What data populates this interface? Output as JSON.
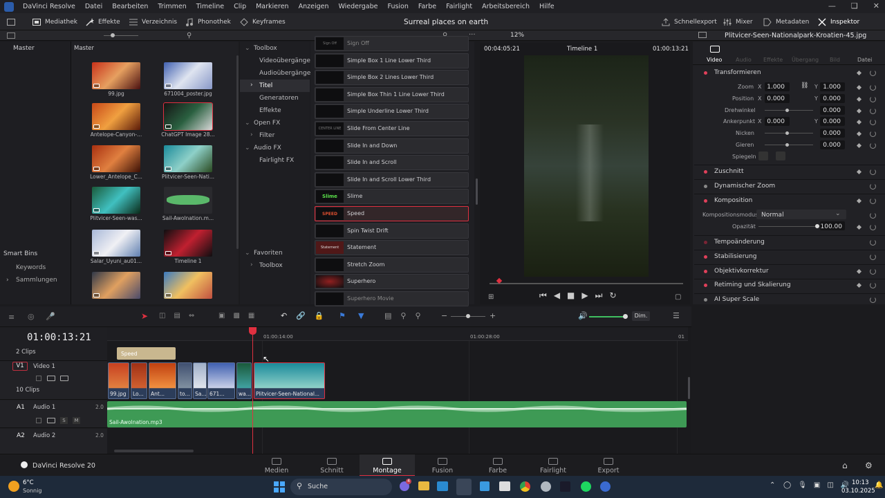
{
  "menu": {
    "app": "DaVinci Resolve",
    "items": [
      "Datei",
      "Bearbeiten",
      "Trimmen",
      "Timeline",
      "Clip",
      "Markieren",
      "Anzeigen",
      "Wiedergabe",
      "Fusion",
      "Farbe",
      "Fairlight",
      "Arbeitsbereich",
      "Hilfe"
    ]
  },
  "toolbar": {
    "mediathek": "Mediathek",
    "effekte": "Effekte",
    "verzeichnis": "Verzeichnis",
    "phonothek": "Phonothek",
    "keyframes": "Keyframes",
    "project_title": "Surreal places on earth",
    "schnellexport": "Schnellexport",
    "mixer": "Mixer",
    "metadaten": "Metadaten",
    "inspektor": "Inspektor"
  },
  "media_pool": {
    "bin_root": "Master",
    "header": "Master",
    "smart_bins": "Smart Bins",
    "smart_items": [
      "Keywords",
      "Sammlungen"
    ],
    "thumbs": [
      {
        "name": "99.jpg",
        "colors": [
          "#c8321a",
          "#e6a060",
          "#4a1010"
        ]
      },
      {
        "name": "671004_poster.jpg",
        "colors": [
          "#4060b0",
          "#dfe4f0",
          "#8898c8"
        ]
      },
      {
        "name": "Antelope-Canyon-...",
        "colors": [
          "#c84818",
          "#f0a040",
          "#5a1a08"
        ]
      },
      {
        "name": "ChatGPT Image 28...",
        "colors": [
          "#141414",
          "#2a6040",
          "#d8d8d8"
        ]
      },
      {
        "name": "Lower_Antelope_C...",
        "colors": [
          "#a83010",
          "#e08040",
          "#3a1005"
        ]
      },
      {
        "name": "Plitvicer-Seen-Nati...",
        "colors": [
          "#1a8a9a",
          "#8ed0c8",
          "#2a4a20"
        ]
      },
      {
        "name": "Plitvicer-Seen-was...",
        "colors": [
          "#1a5a3a",
          "#40c0c0",
          "#0a2a18"
        ]
      },
      {
        "name": "Sail-Awolnation.m...",
        "colors": [
          "#2a2a2e",
          "#5ab86a",
          "#2a2a2e"
        ]
      },
      {
        "name": "Salar_Uyuni_au01...",
        "colors": [
          "#a8b8d8",
          "#f0f0f4",
          "#6080b0"
        ]
      },
      {
        "name": "Timeline 1",
        "colors": [
          "#0e0e10",
          "#c02030",
          "#0e0e10"
        ]
      },
      {
        "name": "",
        "colors": [
          "#303848",
          "#e0a060",
          "#4a4a6a"
        ]
      },
      {
        "name": "",
        "colors": [
          "#3a7ac0",
          "#f0c060",
          "#c05040"
        ]
      }
    ]
  },
  "effects_tree": {
    "toolbox": "Toolbox",
    "video_trans": "Videoübergänge",
    "audio_trans": "Audioübergänge",
    "titel": "Titel",
    "generatoren": "Generatoren",
    "effekte": "Effekte",
    "open_fx": "Open FX",
    "filter": "Filter",
    "audio_fx": "Audio FX",
    "fairlight_fx": "Fairlight FX",
    "favoriten": "Favoriten",
    "toolbox2": "Toolbox"
  },
  "titles": [
    {
      "label": "Sign Off",
      "thumb": "Sign Off"
    },
    {
      "label": "Simple Box 1 Line Lower Third",
      "thumb": ""
    },
    {
      "label": "Simple Box 2 Lines Lower Third",
      "thumb": ""
    },
    {
      "label": "Simple Box Thin 1 Line Lower Third",
      "thumb": ""
    },
    {
      "label": "Simple Underline Lower Third",
      "thumb": ""
    },
    {
      "label": "Slide From Center Line",
      "thumb": "CENTER LINE"
    },
    {
      "label": "Slide In and Down",
      "thumb": ""
    },
    {
      "label": "Slide In and Scroll",
      "thumb": ""
    },
    {
      "label": "Slide In and Scroll Lower Third",
      "thumb": ""
    },
    {
      "label": "Slime",
      "thumb": "Slime"
    },
    {
      "label": "Speed",
      "thumb": "SPEED"
    },
    {
      "label": "Spin Twist Drift",
      "thumb": ""
    },
    {
      "label": "Statement",
      "thumb": "Statement"
    },
    {
      "label": "Stretch Zoom",
      "thumb": ""
    },
    {
      "label": "Superhero",
      "thumb": ""
    },
    {
      "label": "Superhero Movie",
      "thumb": ""
    }
  ],
  "viewer": {
    "zoom": "12%",
    "timecode_left": "00:04:05:21",
    "timeline_name": "Timeline 1",
    "timecode_right": "01:00:13:21"
  },
  "inspector": {
    "filename": "Plitvicer-Seen-Nationalpark-Kroatien-45.jpg",
    "tabs": [
      "Video",
      "Audio",
      "Effekte",
      "Übergang",
      "Bild",
      "Datei"
    ],
    "transform": "Transformieren",
    "zoom": "Zoom",
    "x": "X",
    "y": "Y",
    "zoom_x": "1.000",
    "zoom_y": "1.000",
    "position": "Position",
    "pos_x": "0.000",
    "pos_y": "0.000",
    "drehwinkel": "Drehwinkel",
    "drehwinkel_val": "0.000",
    "ankerpunkt": "Ankerpunkt",
    "anker_x": "0.000",
    "anker_y": "0.000",
    "nicken": "Nicken",
    "nicken_val": "0.000",
    "gieren": "Gieren",
    "gieren_val": "0.000",
    "spiegeln": "Spiegeln",
    "zuschnitt": "Zuschnitt",
    "dyn_zoom": "Dynamischer Zoom",
    "komposition": "Komposition",
    "kompositionsmodus": "Kompositionsmodus",
    "modus_val": "Normal",
    "opazitaet": "Opazität",
    "opazitaet_val": "100.00",
    "tempo": "Tempoänderung",
    "stabil": "Stabilisierung",
    "objektiv": "Objektivkorrektur",
    "retiming": "Retiming und Skalierung",
    "superscale": "AI Super Scale"
  },
  "timeline": {
    "timecode": "01:00:13:21",
    "dim": "Dim.",
    "ruler": [
      "01:00:14:00",
      "01:00:28:00",
      "01"
    ],
    "clips2": "2 Clips",
    "v1": "V1",
    "video1": "Video 1",
    "clips10": "10 Clips",
    "a1": "A1",
    "audio1": "Audio 1",
    "a1_level": "2.0",
    "a2": "A2",
    "audio2": "Audio 2",
    "a2_level": "2.0",
    "speed_clip": "Speed",
    "audio_clip": "Sail-Awolnation.mp3",
    "s": "S",
    "m": "M",
    "video_clips": [
      "99.jpg",
      "Lo...",
      "Ant...",
      "to...",
      "Sa...",
      "671...",
      "wa...",
      "Plitvicer-Seen-National..."
    ]
  },
  "pages": [
    "Medien",
    "Schnitt",
    "Montage",
    "Fusion",
    "Farbe",
    "Fairlight",
    "Export"
  ],
  "brand": "DaVinci Resolve 20",
  "taskbar": {
    "temp": "6°C",
    "weather": "Sonnig",
    "search": "Suche",
    "time": "10:13",
    "date": "03.10.2025",
    "badge": "4"
  }
}
